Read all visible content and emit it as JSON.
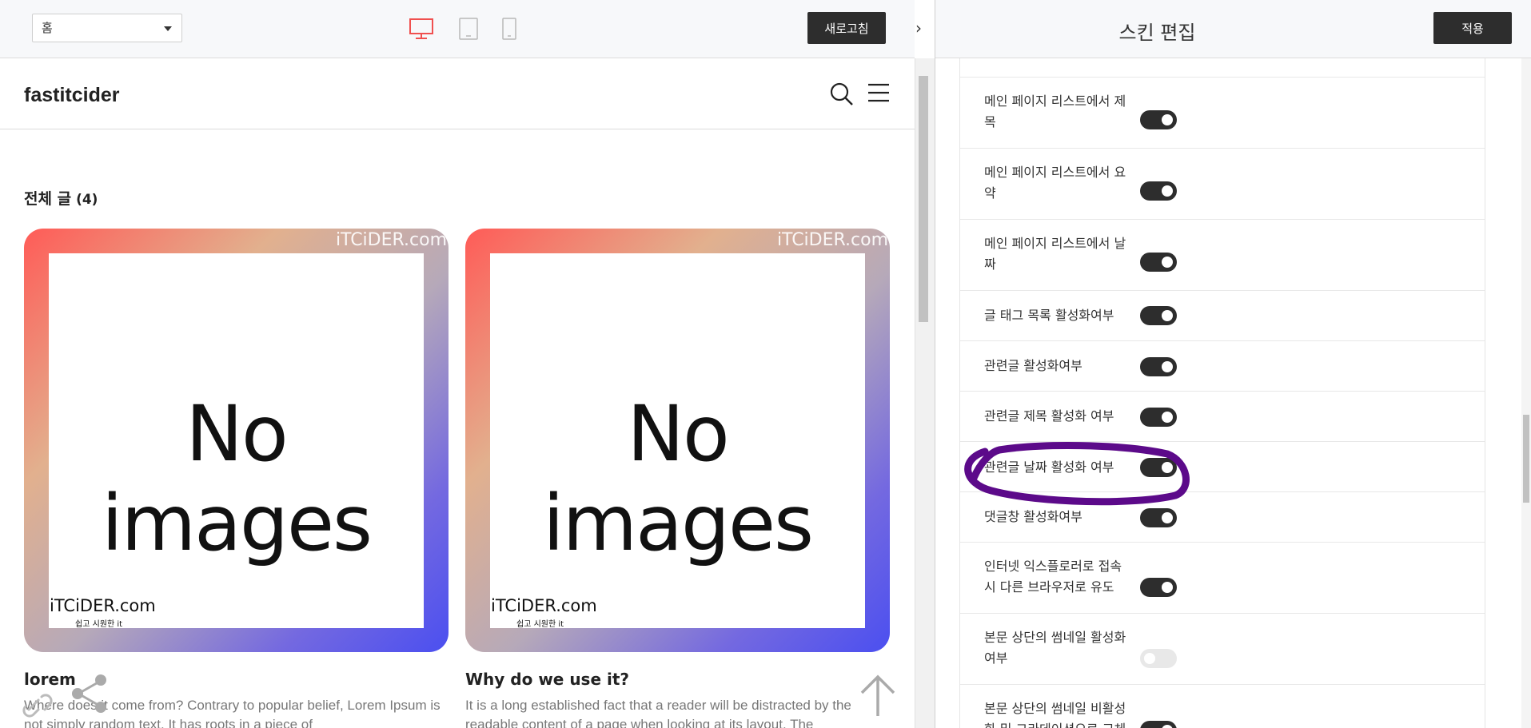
{
  "preview_toolbar": {
    "page_selected": "홈",
    "refresh_label": "새로고침",
    "collapse_glyph": "›"
  },
  "site": {
    "title": "fastitcider",
    "all_posts_label": "전체 글",
    "all_posts_count": "(4)"
  },
  "posts": [
    {
      "title": "lorem",
      "excerpt": "Where does it come from? Contrary to popular belief, Lorem Ipsum is not simply random text. It has roots in a piece of",
      "thumb_text": "No images",
      "watermark_top": "iTCiDER.com",
      "watermark_logo": "iTCiDER.com",
      "watermark_sub": "쉽고 시원한 it"
    },
    {
      "title": "Why do we use it?",
      "excerpt": "It is a long established fact that a reader will be distracted by the readable content of a page when looking at its layout. The",
      "thumb_text": "No images",
      "watermark_top": "iTCiDER.com",
      "watermark_logo": "iTCiDER.com",
      "watermark_sub": "쉽고 시원한 it"
    }
  ],
  "panel": {
    "title": "스킨 편집",
    "apply_label": "적용",
    "settings": [
      {
        "label": "메인 페이지 리스트에서 제목",
        "on": true
      },
      {
        "label": "메인 페이지 리스트에서 요약",
        "on": true
      },
      {
        "label": "메인 페이지 리스트에서 날짜",
        "on": true
      },
      {
        "label": "글 태그 목록 활성화여부",
        "on": true
      },
      {
        "label": "관련글 활성화여부",
        "on": true
      },
      {
        "label": "관련글 제목 활성화 여부",
        "on": true
      },
      {
        "label": "관련글 날짜 활성화 여부",
        "on": true
      },
      {
        "label": "댓글창 활성화여부",
        "on": true
      },
      {
        "label": "인터넷 익스플로러로 접속시 다른 브라우저로 유도",
        "on": true
      },
      {
        "label": "본문 상단의 썸네일 활성화 여부",
        "on": false
      },
      {
        "label": "본문 상단의 썸네일 비활성화 및 그라데이션으로 교체",
        "on": true
      }
    ]
  },
  "colors": {
    "active_device": "#f0504f",
    "toggle_on": "#2d2d2d",
    "toggle_off": "#e8e8e8",
    "annotation": "#5c0a8a"
  },
  "icons": [
    "desktop-icon",
    "tablet-icon",
    "mobile-icon",
    "search-icon",
    "menu-icon",
    "link-icon",
    "share-icon",
    "scroll-top-icon"
  ]
}
